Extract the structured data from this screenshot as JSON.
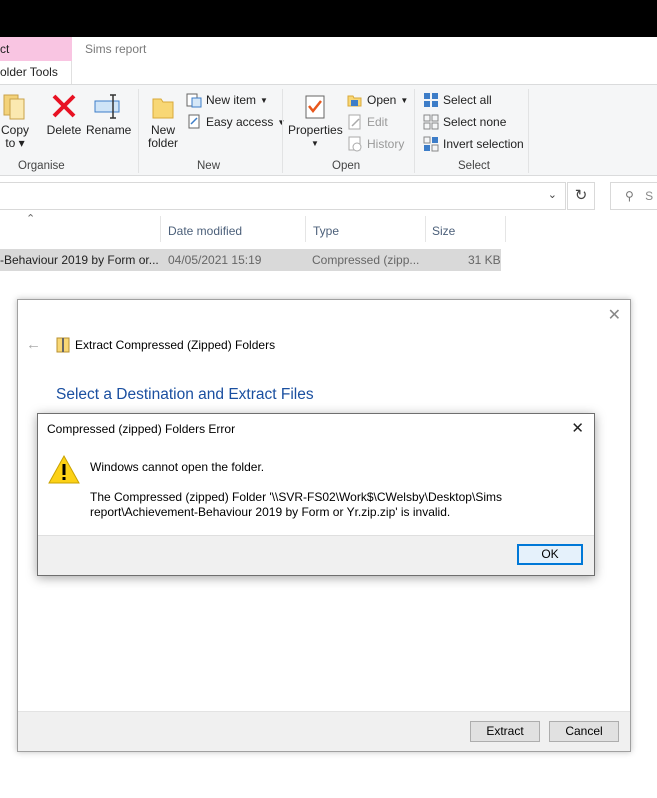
{
  "explorer": {
    "context_tab": "ct",
    "context_subtab": "older Tools",
    "window_tab": "Sims report",
    "ribbon": {
      "organise": {
        "label": "Organise",
        "copy_to": "Copy\nto",
        "delete": "Delete",
        "rename": "Rename"
      },
      "new": {
        "label": "New",
        "new_folder": "New\nfolder",
        "new_item": "New item",
        "easy_access": "Easy access"
      },
      "open": {
        "label": "Open",
        "properties": "Properties",
        "open": "Open",
        "edit": "Edit",
        "history": "History"
      },
      "select": {
        "label": "Select",
        "select_all": "Select all",
        "select_none": "Select none",
        "invert_selection": "Invert selection"
      }
    },
    "search_placeholder": "S",
    "columns": {
      "date_modified": "Date modified",
      "type": "Type",
      "size": "Size"
    },
    "file": {
      "name": "-Behaviour 2019 by Form or...",
      "date": "04/05/2021 15:19",
      "type": "Compressed (zipp...",
      "size": "31 KB"
    }
  },
  "wizard": {
    "title": "Extract Compressed (Zipped) Folders",
    "heading": "Select a Destination and Extract Files",
    "extract_button": "Extract",
    "cancel_button": "Cancel"
  },
  "error_dialog": {
    "title": "Compressed (zipped) Folders Error",
    "message": "Windows cannot open the folder.",
    "detail_line1": "The Compressed (zipped) Folder '\\\\SVR-FS02\\Work$\\CWelsby\\Desktop\\Sims",
    "detail_line2": "report\\Achievement-Behaviour 2019 by Form or Yr.zip.zip' is invalid.",
    "ok_button": "OK"
  },
  "colors": {
    "context_tab": "#f9c5e2",
    "accent": "#0078d7",
    "heading": "#1a4fa0",
    "delete_red": "#e81123"
  }
}
